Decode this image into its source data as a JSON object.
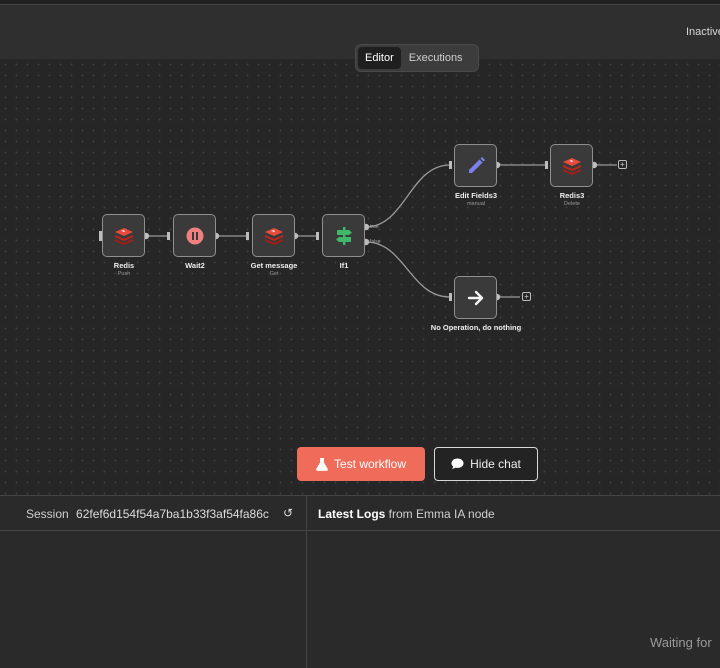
{
  "header": {
    "status": "Inactive"
  },
  "tabs": {
    "editor": "Editor",
    "executions": "Executions"
  },
  "nodes": {
    "redis": {
      "name": "Redis",
      "sub": "Push"
    },
    "wait": {
      "name": "Wait2"
    },
    "get_message": {
      "name": "Get message",
      "sub": "Get"
    },
    "if": {
      "name": "If1",
      "true_label": "true",
      "false_label": "false"
    },
    "edit_fields": {
      "name": "Edit Fields3",
      "sub": "manual"
    },
    "redis3": {
      "name": "Redis3",
      "sub": "Delete"
    },
    "noop": {
      "name": "No Operation, do nothing"
    }
  },
  "buttons": {
    "test_workflow": "Test workflow",
    "hide_chat": "Hide chat"
  },
  "chat": {
    "session_label": "Session",
    "session_id": "62fef6d154f54a7ba1b33f3af54fa86c",
    "logs_bold": "Latest Logs",
    "logs_rest": " from Emma IA node",
    "waiting": "Waiting for"
  },
  "colors": {
    "accent": "#ef6c5a",
    "redis": "#d82c20",
    "wait": "#f08080",
    "if": "#3fb86a",
    "edit": "#7b82f0"
  }
}
